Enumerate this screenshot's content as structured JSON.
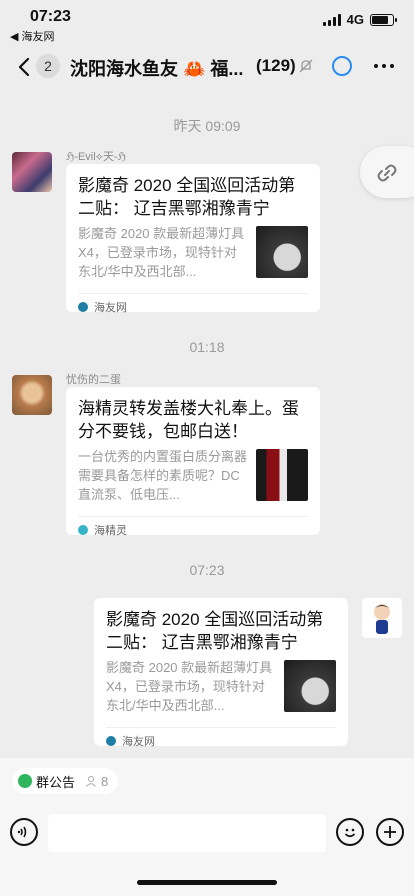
{
  "status": {
    "time": "07:23",
    "back_app": "◀ 海友网",
    "network": "4G"
  },
  "header": {
    "unread": "2",
    "title": "沈阳海水鱼友 🦀 福...",
    "member_count": "(129)"
  },
  "messages": [
    {
      "time_divider": "昨天 09:09",
      "sender": "ℌ-Evil⟡天-ℌ",
      "title": "影魔奇 2020 全国巡回活动第二贴： 辽吉黑鄂湘豫青宁",
      "desc": "影魔奇 2020 款最新超薄灯具 X4，已登录市场，现特针对东北/华中及西北部...",
      "source": "海友网",
      "source_color": "#1f7ea3"
    },
    {
      "time_divider": "01:18",
      "sender": "忧伤的二蛋",
      "title": "海精灵转发盖楼大礼奉上。蛋分不要钱，包邮白送！",
      "desc": "一台优秀的内置蛋白质分离器需要具备怎样的素质呢？DC 直流泵、低电压...",
      "source": "海精灵",
      "source_color": "#35b4c8"
    },
    {
      "time_divider": "07:23",
      "sender": "",
      "title": "影魔奇 2020 全国巡回活动第二贴： 辽吉黑鄂湘豫青宁",
      "desc": "影魔奇 2020 款最新超薄灯具 X4，已登录市场，现特针对东北/华中及西北部...",
      "source": "海友网",
      "source_color": "#1f7ea3"
    }
  ],
  "bottom": {
    "notice_label": "群公告",
    "notice_count": "8",
    "input_placeholder": ""
  },
  "colors": {
    "background": "#ededed",
    "accent_blue": "#2a8cf0",
    "notice_green": "#2fb55d"
  },
  "icons": [
    "back-icon",
    "mute-icon",
    "ring-icon",
    "more-icon",
    "link-icon",
    "voice-icon",
    "emoji-icon",
    "plus-icon",
    "person-icon"
  ]
}
